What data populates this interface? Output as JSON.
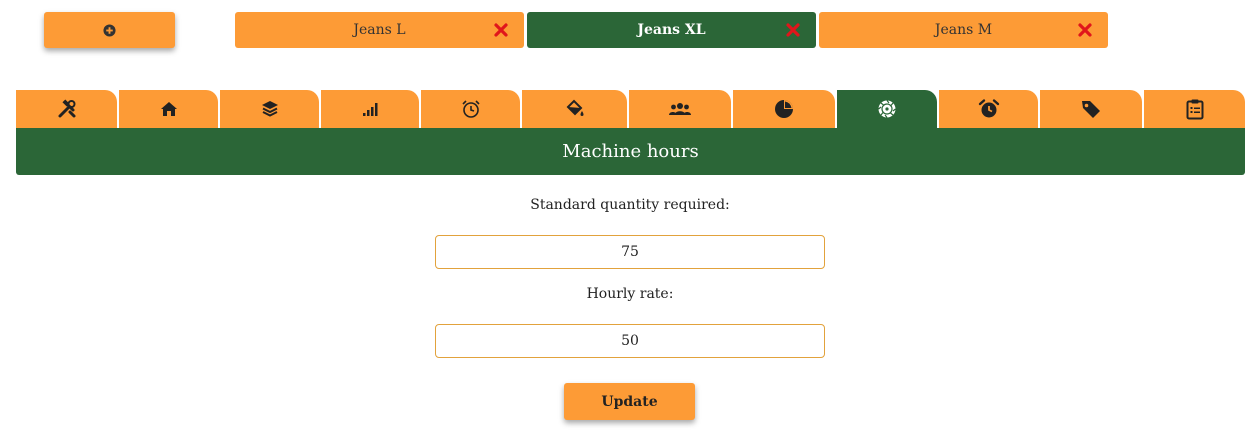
{
  "colors": {
    "accent": "#fd9b36",
    "active": "#2b6637",
    "close": "#e0161b",
    "field_border": "#e2a23c"
  },
  "add_button": {
    "icon": "plus-circle-icon"
  },
  "product_tabs": [
    {
      "label": "Jeans L",
      "active": false
    },
    {
      "label": "Jeans XL",
      "active": true
    },
    {
      "label": "Jeans M",
      "active": false
    }
  ],
  "category_tabs": [
    {
      "icon": "tools-icon",
      "active": false
    },
    {
      "icon": "home-icon",
      "active": false
    },
    {
      "icon": "layers-icon",
      "active": false
    },
    {
      "icon": "signal-bars-icon",
      "active": false
    },
    {
      "icon": "alarm-clock-outline-icon",
      "active": false
    },
    {
      "icon": "paint-bucket-icon",
      "active": false
    },
    {
      "icon": "users-icon",
      "active": false
    },
    {
      "icon": "pie-chart-icon",
      "active": false
    },
    {
      "icon": "saw-blade-icon",
      "active": true
    },
    {
      "icon": "alarm-clock-icon",
      "active": false
    },
    {
      "icon": "tags-icon",
      "active": false
    },
    {
      "icon": "clipboard-list-icon",
      "active": false
    }
  ],
  "section": {
    "title": "Machine hours"
  },
  "form": {
    "quantity_label": "Standard quantity required:",
    "quantity_value": "75",
    "rate_label": "Hourly rate:",
    "rate_value": "50",
    "update_label": "Update"
  }
}
